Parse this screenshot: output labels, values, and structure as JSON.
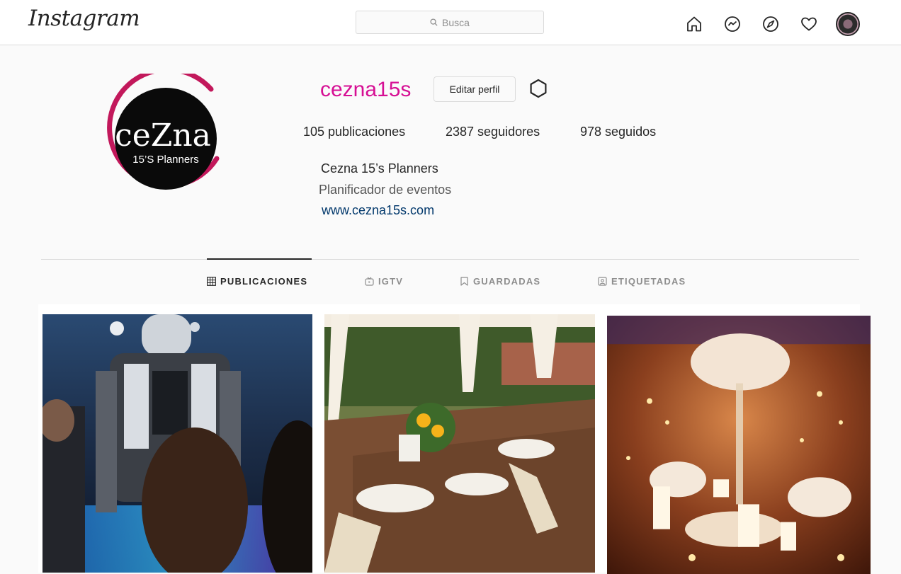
{
  "nav": {
    "logo": "Instagram",
    "search_placeholder": "Busca",
    "icons": [
      "home-icon",
      "messenger-icon",
      "explore-icon",
      "heart-icon"
    ]
  },
  "profile": {
    "username": "cezna15s",
    "edit_label": "Editar perfil",
    "stats": {
      "posts": "105 publicaciones",
      "followers": "2387 seguidores",
      "following": "978 seguidos"
    },
    "bio": {
      "name": "Cezna 15’s Planners",
      "category": "Planificador de eventos",
      "link": "www.cezna15s.com"
    },
    "logo_text": {
      "line1": "ceZna",
      "line2": "15’S Planners"
    }
  },
  "tabs": [
    {
      "label": "PUBLICACIONES",
      "active": true
    },
    {
      "label": "IGTV",
      "active": false
    },
    {
      "label": "GUARDADAS",
      "active": false
    },
    {
      "label": "ETIQUETADAS",
      "active": false
    }
  ],
  "colors": {
    "username": "#d60f94",
    "logo_ring": "#c2185b",
    "link": "#00376b"
  }
}
